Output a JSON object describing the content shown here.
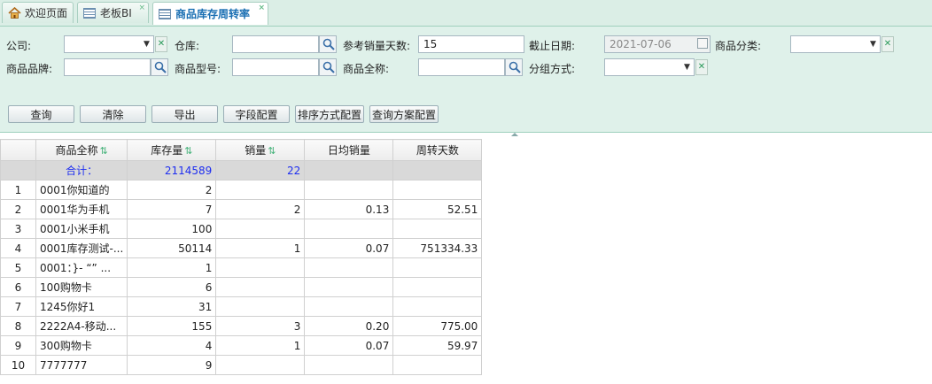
{
  "tabs": [
    {
      "label": "欢迎页面"
    },
    {
      "label": "老板BI",
      "close": "×"
    },
    {
      "label": "商品库存周转率",
      "close": "×"
    }
  ],
  "filters": {
    "company_label": "公司:",
    "company_value": "",
    "warehouse_label": "仓库:",
    "warehouse_value": "",
    "ref_days_label": "参考销量天数:",
    "ref_days_value": "15",
    "end_date_label": "截止日期:",
    "end_date_value": "2021-07-06",
    "category_label": "商品分类:",
    "category_value": "",
    "brand_label": "商品品牌:",
    "brand_value": "",
    "model_label": "商品型号:",
    "model_value": "",
    "fullname_label": "商品全称:",
    "fullname_value": "",
    "group_label": "分组方式:",
    "group_value": ""
  },
  "buttons": {
    "query": "查询",
    "clear": "清除",
    "export": "导出",
    "field_config": "字段配置",
    "sort_config": "排序方式配置",
    "query_plan_config": "查询方案配置"
  },
  "table": {
    "headers": [
      "商品全称",
      "库存量",
      "销量",
      "日均销量",
      "周转天数"
    ],
    "sum_row": {
      "label": "合计：",
      "stock": "2114589",
      "sales": "22"
    },
    "rows": [
      {
        "no": "1",
        "name": "0001你知道的",
        "stock": "2",
        "sales": "",
        "daily": "",
        "turnover": ""
      },
      {
        "no": "2",
        "name": "0001华为手机",
        "stock": "7",
        "sales": "2",
        "daily": "0.13",
        "turnover": "52.51"
      },
      {
        "no": "3",
        "name": "0001小米手机",
        "stock": "100",
        "sales": "",
        "daily": "",
        "turnover": ""
      },
      {
        "no": "4",
        "name": "0001库存测试-...",
        "stock": "50114",
        "sales": "1",
        "daily": "0.07",
        "turnover": "751334.33"
      },
      {
        "no": "5",
        "name": "0001：}- “” ...",
        "stock": "1",
        "sales": "",
        "daily": "",
        "turnover": ""
      },
      {
        "no": "6",
        "name": "100购物卡",
        "stock": "6",
        "sales": "",
        "daily": "",
        "turnover": ""
      },
      {
        "no": "7",
        "name": "1245你好1",
        "stock": "31",
        "sales": "",
        "daily": "",
        "turnover": ""
      },
      {
        "no": "8",
        "name": "2222A4-移动...",
        "stock": "155",
        "sales": "3",
        "daily": "0.20",
        "turnover": "775.00"
      },
      {
        "no": "9",
        "name": "300购物卡",
        "stock": "4",
        "sales": "1",
        "daily": "0.07",
        "turnover": "59.97"
      },
      {
        "no": "10",
        "name": "7777777",
        "stock": "9",
        "sales": "",
        "daily": "",
        "turnover": ""
      }
    ]
  },
  "sort_icon": "⇅"
}
